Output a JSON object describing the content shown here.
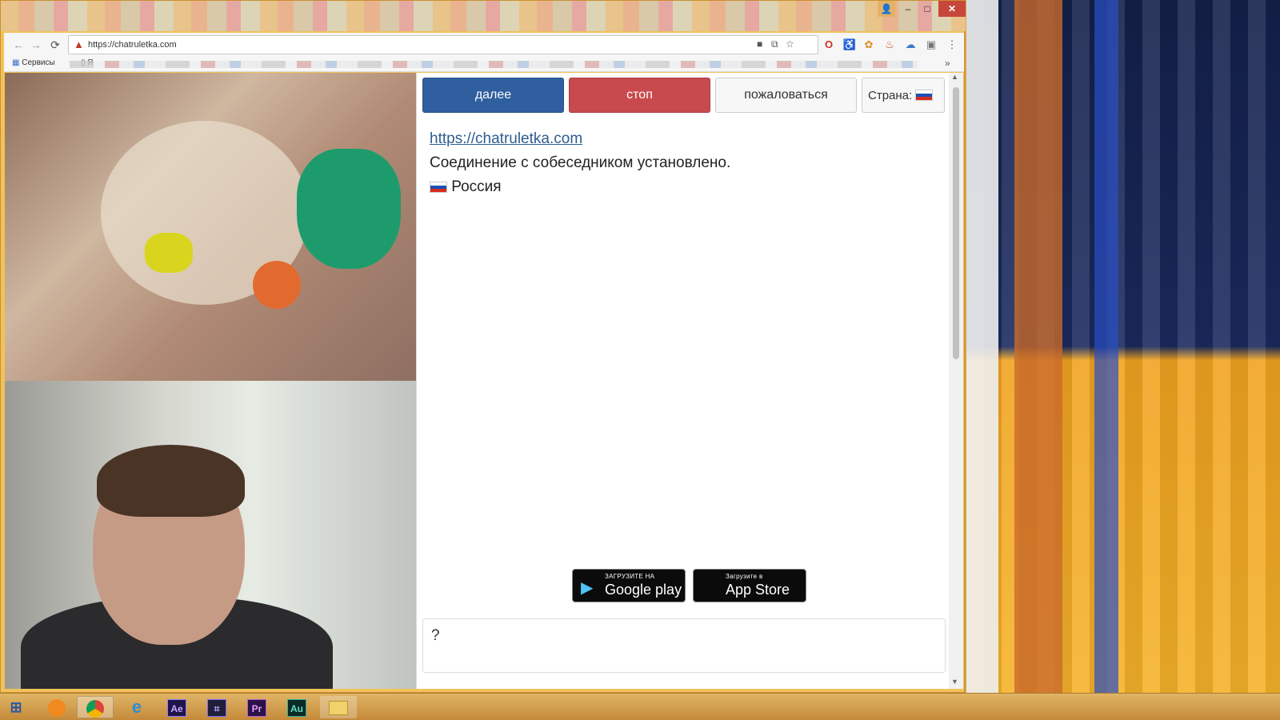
{
  "window": {
    "controls": {
      "user": "👤",
      "minimize": "–",
      "maximize": "□",
      "close": "✕"
    }
  },
  "toolbar": {
    "back_icon": "←",
    "forward_icon": "→",
    "reload_icon": "⟳",
    "url": "https://chatruletka.com",
    "icons": [
      "camera-icon",
      "translate-icon",
      "star-icon"
    ],
    "menu_icon": "⋮"
  },
  "bookmarks": {
    "apps_label": "Сервисы",
    "first_item": "Я",
    "more": "»"
  },
  "chat": {
    "buttons": {
      "next": "далее",
      "stop": "стоп",
      "report": "пожаловаться",
      "country": "Страна:"
    },
    "messages": {
      "link": "https://chatruletka.com",
      "status": "Соединение с собеседником установлено.",
      "country_name": "Россия"
    },
    "store": {
      "google_small": "ЗАГРУЗИТЕ НА",
      "google_big": "Google play",
      "apple_small": "Загрузите в",
      "apple_big": "App Store"
    },
    "input_value": "?"
  },
  "taskbar": {
    "items": [
      {
        "name": "windows-start-icon"
      },
      {
        "name": "orange-app-icon"
      },
      {
        "name": "chrome-icon"
      },
      {
        "name": "internet-explorer-icon"
      },
      {
        "name": "after-effects-icon",
        "label": "Ae"
      },
      {
        "name": "media-encoder-icon",
        "label": "⌗"
      },
      {
        "name": "premiere-icon",
        "label": "Pr"
      },
      {
        "name": "audition-icon",
        "label": "Au"
      },
      {
        "name": "file-explorer-icon"
      }
    ]
  },
  "colors": {
    "next_button": "#2f5f9f",
    "stop_button": "#c84a4e",
    "link": "#2e5d8f",
    "mask": "#1e9b6c"
  }
}
